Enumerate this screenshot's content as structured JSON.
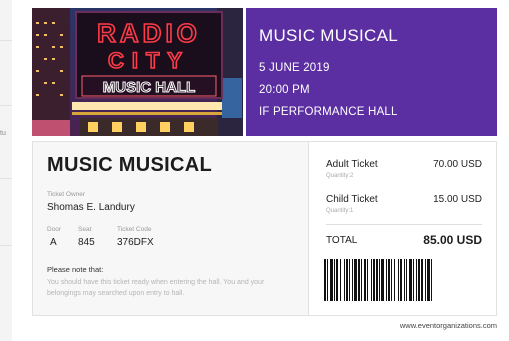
{
  "background": {
    "partial_text": "tu"
  },
  "event": {
    "title": "MUSIC MUSICAL",
    "date": "5 JUNE 2019",
    "time": "20:00 PM",
    "venue": "IF PERFORMANCE HALL",
    "image_sign": {
      "line1": "RADIO",
      "line2": "CITY",
      "line3": "MUSIC HALL"
    }
  },
  "ticket": {
    "title": "MUSIC MUSICAL",
    "owner_label": "Ticket Owner",
    "owner_name": "Shomas E. Landury",
    "door_label": "Door",
    "door": "A",
    "seat_label": "Seat",
    "seat": "845",
    "code_label": "Ticket Code",
    "code": "376DFX",
    "note_title": "Please note that:",
    "note_body": "You should have this ticket ready when entering the hall. You and your belongings may searched upon entry to hall."
  },
  "order": {
    "items": [
      {
        "label": "Adult Ticket",
        "qty": "Quantity:2",
        "price": "70.00 USD"
      },
      {
        "label": "Child Ticket",
        "qty": "Quantity:1",
        "price": "15.00 USD"
      }
    ],
    "total_label": "TOTAL",
    "total": "85.00 USD"
  },
  "footer": {
    "website": "www.eventorganizations.com"
  },
  "colors": {
    "accent": "#5b2fa1",
    "neon_red": "#ff3344"
  }
}
